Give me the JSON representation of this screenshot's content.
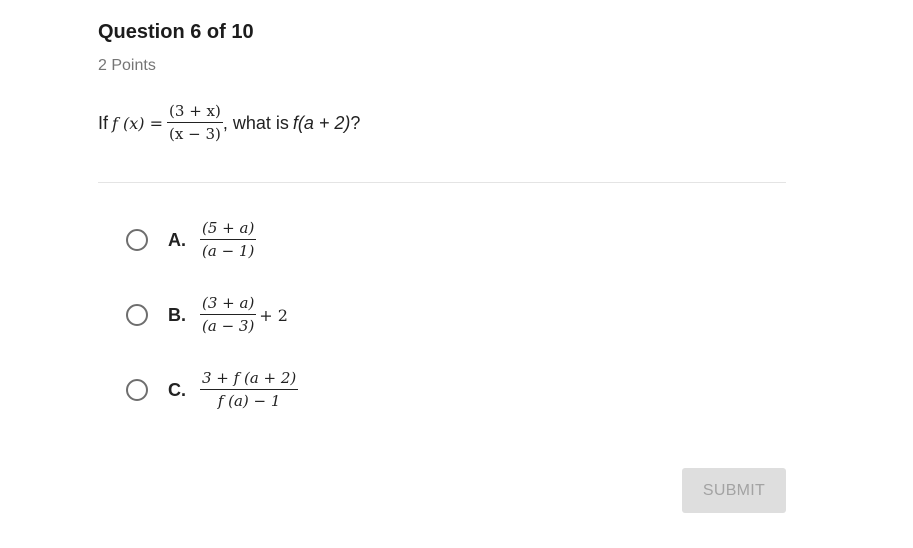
{
  "question": {
    "title": "Question 6 of 10",
    "points": "2 Points",
    "prompt_prefix": "If",
    "function_lhs": "f (x) =",
    "numerator": "(3 + x)",
    "denominator": "(x − 3)",
    "prompt_middle": ", what is",
    "target_expr": "f(a + 2)",
    "prompt_suffix": "?"
  },
  "options": [
    {
      "letter": "A.",
      "numerator": "(5 + a)",
      "denominator": "(a − 1)",
      "tail": ""
    },
    {
      "letter": "B.",
      "numerator": "(3 + a)",
      "denominator": "(a − 3)",
      "tail": "+ 2"
    },
    {
      "letter": "C.",
      "numerator": "3 + f (a + 2)",
      "denominator": "f (a) − 1",
      "tail": ""
    }
  ],
  "submit": {
    "label": "SUBMIT"
  },
  "colors": {
    "submit_bg": "#dedede",
    "submit_text": "#a3a3a3",
    "radio_border": "#6e6e6e",
    "divider": "#e4e4e4"
  }
}
